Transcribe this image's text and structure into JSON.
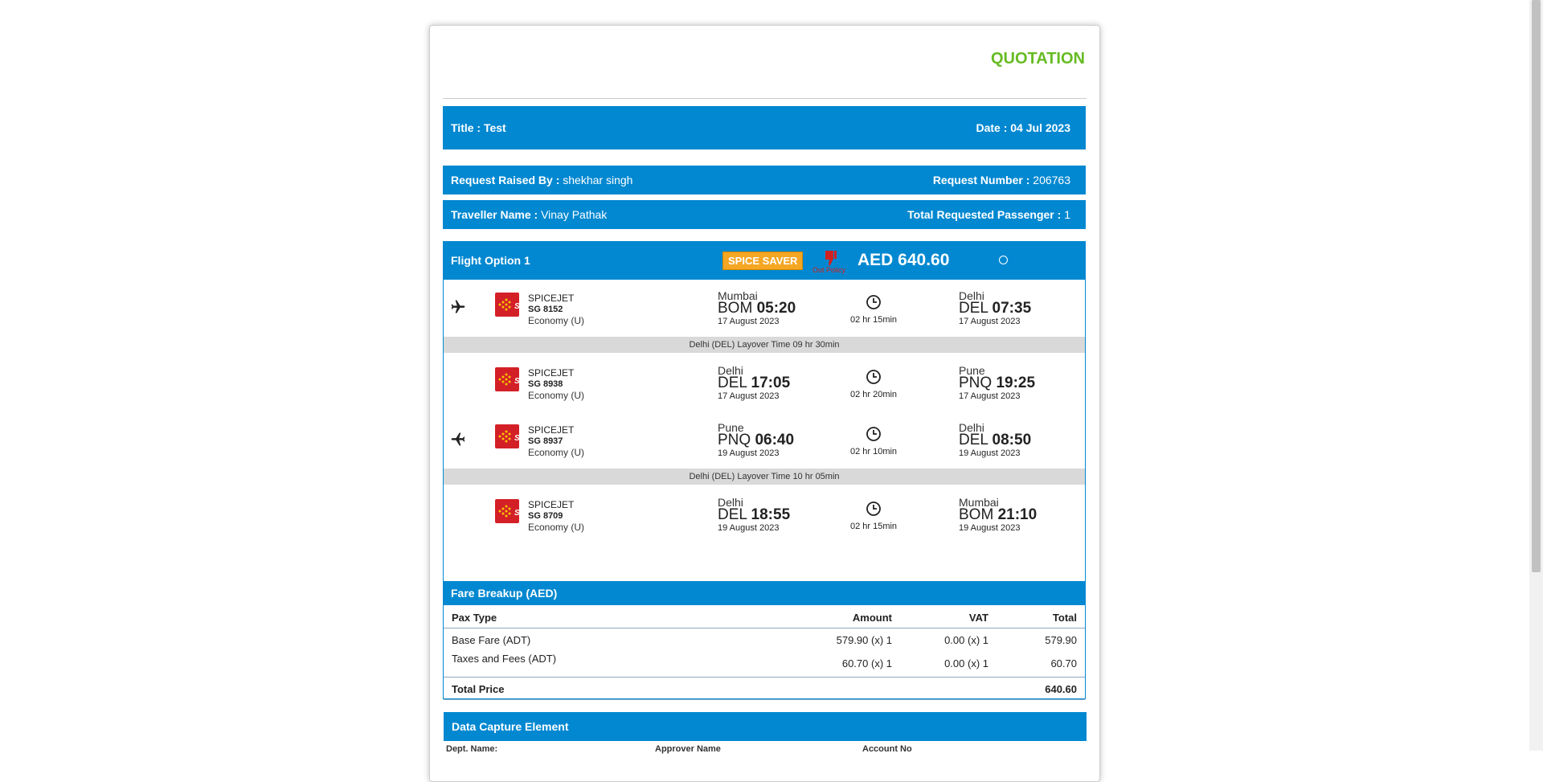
{
  "document": {
    "heading": "QUOTATION",
    "title_label": "Title  :",
    "title_value": "Test",
    "date_label": "Date :",
    "date_value": "04 Jul 2023",
    "request_raised_label": "Request Raised By :",
    "request_raised_value": "shekhar singh",
    "request_number_label": "Request Number :",
    "request_number_value": "206763",
    "traveller_label": "Traveller Name :",
    "traveller_value": "Vinay Pathak",
    "passenger_label": "Total Requested Passenger :",
    "passenger_value": "1"
  },
  "option": {
    "name": "Flight Option 1",
    "fare_brand": "SPICE SAVER",
    "policy": "Out Policy",
    "price": "AED 640.60",
    "colors": {
      "header": "#0288d1",
      "brand_badge": "#f5a623",
      "logo": "#d32027"
    }
  },
  "segments": [
    {
      "direction_icon": "plane-outbound-icon",
      "airline": "SPICEJET",
      "flight": "SG 8152",
      "cabin": "Economy (U)",
      "dep_city": "Mumbai",
      "dep_code": "BOM",
      "dep_time": "05:20",
      "dep_date": "17 August 2023",
      "duration": "02 hr 15min",
      "arr_city": "Delhi",
      "arr_code": "DEL",
      "arr_time": "07:35",
      "arr_date": "17 August 2023"
    },
    {
      "direction_icon": "",
      "airline": "SPICEJET",
      "flight": "SG 8938",
      "cabin": "Economy (U)",
      "dep_city": "Delhi",
      "dep_code": "DEL",
      "dep_time": "17:05",
      "dep_date": "17 August 2023",
      "duration": "02 hr 20min",
      "arr_city": "Pune",
      "arr_code": "PNQ",
      "arr_time": "19:25",
      "arr_date": "17 August 2023"
    },
    {
      "direction_icon": "plane-return-icon",
      "airline": "SPICEJET",
      "flight": "SG 8937",
      "cabin": "Economy (U)",
      "dep_city": "Pune",
      "dep_code": "PNQ",
      "dep_time": "06:40",
      "dep_date": "19 August 2023",
      "duration": "02 hr 10min",
      "arr_city": "Delhi",
      "arr_code": "DEL",
      "arr_time": "08:50",
      "arr_date": "19 August 2023"
    },
    {
      "direction_icon": "",
      "airline": "SPICEJET",
      "flight": "SG 8709",
      "cabin": "Economy (U)",
      "dep_city": "Delhi",
      "dep_code": "DEL",
      "dep_time": "18:55",
      "dep_date": "19 August 2023",
      "duration": "02 hr 15min",
      "arr_city": "Mumbai",
      "arr_code": "BOM",
      "arr_time": "21:10",
      "arr_date": "19 August 2023"
    }
  ],
  "layovers": [
    "Delhi (DEL) Layover Time 09 hr 30min",
    "Delhi (DEL) Layover Time 10 hr 05min"
  ],
  "fare": {
    "heading": "Fare Breakup (AED)",
    "columns": [
      "Pax Type",
      "Amount",
      "VAT",
      "Total"
    ],
    "rows": [
      [
        "Base Fare (ADT)",
        "579.90 (x) 1",
        "0.00 (x) 1",
        "579.90"
      ],
      [
        "Taxes and Fees (ADT)",
        "60.70 (x) 1",
        "0.00 (x) 1",
        "60.70"
      ]
    ],
    "total_label": "Total Price",
    "total_value": "640.60"
  },
  "data_capture": {
    "heading": "Data Capture Element",
    "columns": [
      "Dept. Name:",
      "Approver Name",
      "Account No"
    ]
  }
}
